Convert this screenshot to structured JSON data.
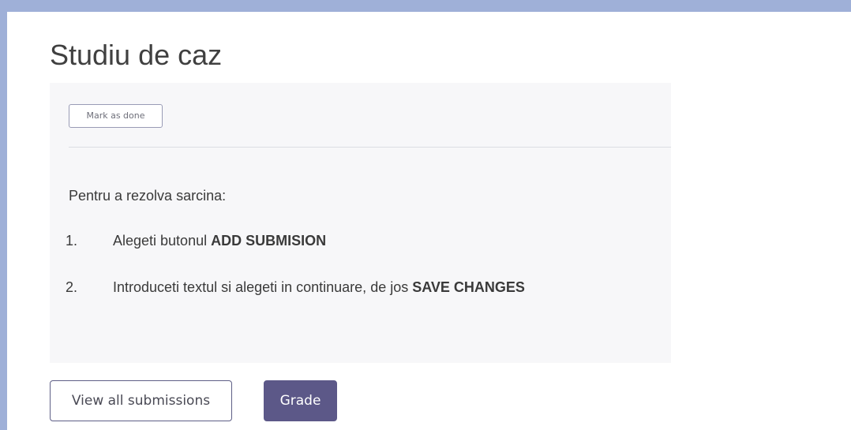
{
  "page": {
    "title": "Studiu de caz"
  },
  "activity": {
    "mark_done_label": "Mark as done",
    "intro": "Pentru a rezolva sarcina:",
    "steps": [
      {
        "number": "1.",
        "text": "Alegeti butonul ",
        "highlight": "ADD SUBMISION"
      },
      {
        "number": "2.",
        "text": "Introduceti textul si alegeti in continuare, de jos ",
        "highlight": "SAVE CHANGES"
      }
    ]
  },
  "actions": {
    "view_all_label": "View all submissions",
    "grade_label": "Grade"
  },
  "colors": {
    "frame": "#9fb0d8",
    "panel_background": "#f7f7f9",
    "primary_button": "#5c5888",
    "title_text": "#404040"
  }
}
